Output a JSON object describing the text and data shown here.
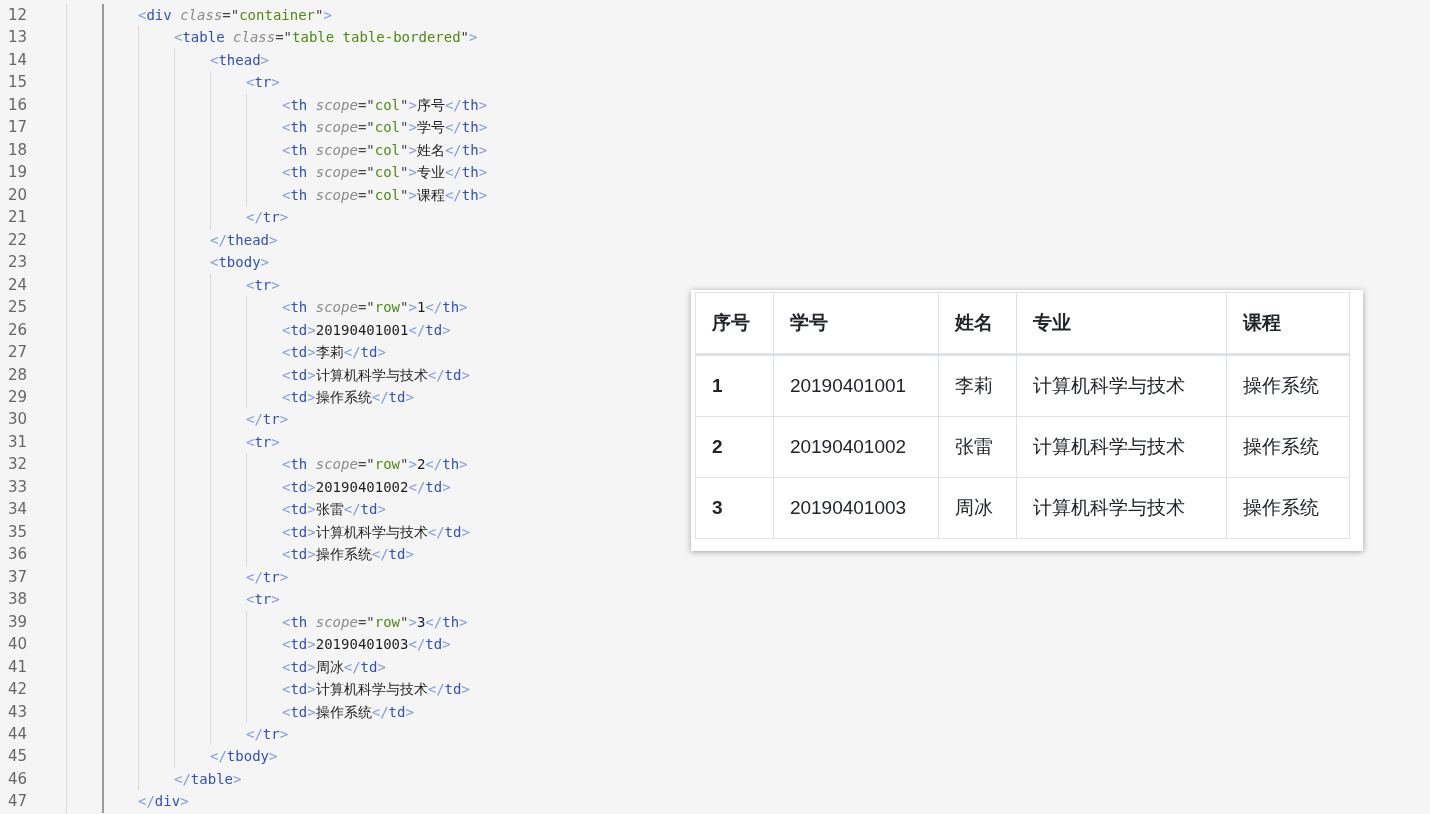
{
  "editor": {
    "lines": [
      {
        "number": "12",
        "tokens": [
          {
            "kind": "bracket",
            "text": "<"
          },
          {
            "kind": "tag",
            "text": "div"
          },
          {
            "kind": "attr",
            "text": " class"
          },
          {
            "kind": "plain",
            "text": "=\""
          },
          {
            "kind": "string",
            "text": "container"
          },
          {
            "kind": "plain",
            "text": "\""
          },
          {
            "kind": "bracket",
            "text": ">"
          }
        ],
        "children": [
          {
            "number": "13",
            "tokens": [
              {
                "kind": "bracket",
                "text": "<"
              },
              {
                "kind": "tag",
                "text": "table"
              },
              {
                "kind": "attr",
                "text": " class"
              },
              {
                "kind": "plain",
                "text": "=\""
              },
              {
                "kind": "string",
                "text": "table table-bordered"
              },
              {
                "kind": "plain",
                "text": "\""
              },
              {
                "kind": "bracket",
                "text": ">"
              }
            ],
            "children": [
              {
                "number": "14",
                "tokens": [
                  {
                    "kind": "bracket",
                    "text": "<"
                  },
                  {
                    "kind": "tag",
                    "text": "thead"
                  },
                  {
                    "kind": "bracket",
                    "text": ">"
                  }
                ],
                "children": [
                  {
                    "number": "15",
                    "tokens": [
                      {
                        "kind": "bracket",
                        "text": "<"
                      },
                      {
                        "kind": "tag",
                        "text": "tr"
                      },
                      {
                        "kind": "bracket",
                        "text": ">"
                      }
                    ],
                    "children": [
                      {
                        "number": "16",
                        "tokens": [
                          {
                            "kind": "bracket",
                            "text": "<"
                          },
                          {
                            "kind": "tag",
                            "text": "th"
                          },
                          {
                            "kind": "attr",
                            "text": " scope"
                          },
                          {
                            "kind": "plain",
                            "text": "=\""
                          },
                          {
                            "kind": "string",
                            "text": "col"
                          },
                          {
                            "kind": "plain",
                            "text": "\""
                          },
                          {
                            "kind": "bracket",
                            "text": ">"
                          },
                          {
                            "kind": "text",
                            "text": "序号"
                          },
                          {
                            "kind": "bracket",
                            "text": "</"
                          },
                          {
                            "kind": "tag",
                            "text": "th"
                          },
                          {
                            "kind": "bracket",
                            "text": ">"
                          }
                        ]
                      },
                      {
                        "number": "17",
                        "tokens": [
                          {
                            "kind": "bracket",
                            "text": "<"
                          },
                          {
                            "kind": "tag",
                            "text": "th"
                          },
                          {
                            "kind": "attr",
                            "text": " scope"
                          },
                          {
                            "kind": "plain",
                            "text": "=\""
                          },
                          {
                            "kind": "string",
                            "text": "col"
                          },
                          {
                            "kind": "plain",
                            "text": "\""
                          },
                          {
                            "kind": "bracket",
                            "text": ">"
                          },
                          {
                            "kind": "text",
                            "text": "学号"
                          },
                          {
                            "kind": "bracket",
                            "text": "</"
                          },
                          {
                            "kind": "tag",
                            "text": "th"
                          },
                          {
                            "kind": "bracket",
                            "text": ">"
                          }
                        ]
                      },
                      {
                        "number": "18",
                        "tokens": [
                          {
                            "kind": "bracket",
                            "text": "<"
                          },
                          {
                            "kind": "tag",
                            "text": "th"
                          },
                          {
                            "kind": "attr",
                            "text": " scope"
                          },
                          {
                            "kind": "plain",
                            "text": "=\""
                          },
                          {
                            "kind": "string",
                            "text": "col"
                          },
                          {
                            "kind": "plain",
                            "text": "\""
                          },
                          {
                            "kind": "bracket",
                            "text": ">"
                          },
                          {
                            "kind": "text",
                            "text": "姓名"
                          },
                          {
                            "kind": "bracket",
                            "text": "</"
                          },
                          {
                            "kind": "tag",
                            "text": "th"
                          },
                          {
                            "kind": "bracket",
                            "text": ">"
                          }
                        ]
                      },
                      {
                        "number": "19",
                        "tokens": [
                          {
                            "kind": "bracket",
                            "text": "<"
                          },
                          {
                            "kind": "tag",
                            "text": "th"
                          },
                          {
                            "kind": "attr",
                            "text": " scope"
                          },
                          {
                            "kind": "plain",
                            "text": "=\""
                          },
                          {
                            "kind": "string",
                            "text": "col"
                          },
                          {
                            "kind": "plain",
                            "text": "\""
                          },
                          {
                            "kind": "bracket",
                            "text": ">"
                          },
                          {
                            "kind": "text",
                            "text": "专业"
                          },
                          {
                            "kind": "bracket",
                            "text": "</"
                          },
                          {
                            "kind": "tag",
                            "text": "th"
                          },
                          {
                            "kind": "bracket",
                            "text": ">"
                          }
                        ]
                      },
                      {
                        "number": "20",
                        "tokens": [
                          {
                            "kind": "bracket",
                            "text": "<"
                          },
                          {
                            "kind": "tag",
                            "text": "th"
                          },
                          {
                            "kind": "attr",
                            "text": " scope"
                          },
                          {
                            "kind": "plain",
                            "text": "=\""
                          },
                          {
                            "kind": "string",
                            "text": "col"
                          },
                          {
                            "kind": "plain",
                            "text": "\""
                          },
                          {
                            "kind": "bracket",
                            "text": ">"
                          },
                          {
                            "kind": "text",
                            "text": "课程"
                          },
                          {
                            "kind": "bracket",
                            "text": "</"
                          },
                          {
                            "kind": "tag",
                            "text": "th"
                          },
                          {
                            "kind": "bracket",
                            "text": ">"
                          }
                        ]
                      }
                    ]
                  },
                  {
                    "number": "21",
                    "tokens": [
                      {
                        "kind": "bracket",
                        "text": "</"
                      },
                      {
                        "kind": "tag",
                        "text": "tr"
                      },
                      {
                        "kind": "bracket",
                        "text": ">"
                      }
                    ]
                  }
                ]
              },
              {
                "number": "22",
                "tokens": [
                  {
                    "kind": "bracket",
                    "text": "</"
                  },
                  {
                    "kind": "tag",
                    "text": "thead"
                  },
                  {
                    "kind": "bracket",
                    "text": ">"
                  }
                ]
              },
              {
                "number": "23",
                "tokens": [
                  {
                    "kind": "bracket",
                    "text": "<"
                  },
                  {
                    "kind": "tag",
                    "text": "tbody"
                  },
                  {
                    "kind": "bracket",
                    "text": ">"
                  }
                ],
                "children": [
                  {
                    "number": "24",
                    "tokens": [
                      {
                        "kind": "bracket",
                        "text": "<"
                      },
                      {
                        "kind": "tag",
                        "text": "tr"
                      },
                      {
                        "kind": "bracket",
                        "text": ">"
                      }
                    ],
                    "children": [
                      {
                        "number": "25",
                        "tokens": [
                          {
                            "kind": "bracket",
                            "text": "<"
                          },
                          {
                            "kind": "tag",
                            "text": "th"
                          },
                          {
                            "kind": "attr",
                            "text": " scope"
                          },
                          {
                            "kind": "plain",
                            "text": "=\""
                          },
                          {
                            "kind": "string",
                            "text": "row"
                          },
                          {
                            "kind": "plain",
                            "text": "\""
                          },
                          {
                            "kind": "bracket",
                            "text": ">"
                          },
                          {
                            "kind": "text",
                            "text": "1"
                          },
                          {
                            "kind": "bracket",
                            "text": "</"
                          },
                          {
                            "kind": "tag",
                            "text": "th"
                          },
                          {
                            "kind": "bracket",
                            "text": ">"
                          }
                        ]
                      },
                      {
                        "number": "26",
                        "tokens": [
                          {
                            "kind": "bracket",
                            "text": "<"
                          },
                          {
                            "kind": "tag",
                            "text": "td"
                          },
                          {
                            "kind": "bracket",
                            "text": ">"
                          },
                          {
                            "kind": "text",
                            "text": "20190401001"
                          },
                          {
                            "kind": "bracket",
                            "text": "</"
                          },
                          {
                            "kind": "tag",
                            "text": "td"
                          },
                          {
                            "kind": "bracket",
                            "text": ">"
                          }
                        ]
                      },
                      {
                        "number": "27",
                        "tokens": [
                          {
                            "kind": "bracket",
                            "text": "<"
                          },
                          {
                            "kind": "tag",
                            "text": "td"
                          },
                          {
                            "kind": "bracket",
                            "text": ">"
                          },
                          {
                            "kind": "text",
                            "text": "李莉"
                          },
                          {
                            "kind": "bracket",
                            "text": "</"
                          },
                          {
                            "kind": "tag",
                            "text": "td"
                          },
                          {
                            "kind": "bracket",
                            "text": ">"
                          }
                        ]
                      },
                      {
                        "number": "28",
                        "tokens": [
                          {
                            "kind": "bracket",
                            "text": "<"
                          },
                          {
                            "kind": "tag",
                            "text": "td"
                          },
                          {
                            "kind": "bracket",
                            "text": ">"
                          },
                          {
                            "kind": "text",
                            "text": "计算机科学与技术"
                          },
                          {
                            "kind": "bracket",
                            "text": "</"
                          },
                          {
                            "kind": "tag",
                            "text": "td"
                          },
                          {
                            "kind": "bracket",
                            "text": ">"
                          }
                        ]
                      },
                      {
                        "number": "29",
                        "tokens": [
                          {
                            "kind": "bracket",
                            "text": "<"
                          },
                          {
                            "kind": "tag",
                            "text": "td"
                          },
                          {
                            "kind": "bracket",
                            "text": ">"
                          },
                          {
                            "kind": "text",
                            "text": "操作系统"
                          },
                          {
                            "kind": "bracket",
                            "text": "</"
                          },
                          {
                            "kind": "tag",
                            "text": "td"
                          },
                          {
                            "kind": "bracket",
                            "text": ">"
                          }
                        ]
                      }
                    ]
                  },
                  {
                    "number": "30",
                    "tokens": [
                      {
                        "kind": "bracket",
                        "text": "</"
                      },
                      {
                        "kind": "tag",
                        "text": "tr"
                      },
                      {
                        "kind": "bracket",
                        "text": ">"
                      }
                    ]
                  },
                  {
                    "number": "31",
                    "tokens": [
                      {
                        "kind": "bracket",
                        "text": "<"
                      },
                      {
                        "kind": "tag",
                        "text": "tr"
                      },
                      {
                        "kind": "bracket",
                        "text": ">"
                      }
                    ],
                    "children": [
                      {
                        "number": "32",
                        "tokens": [
                          {
                            "kind": "bracket",
                            "text": "<"
                          },
                          {
                            "kind": "tag",
                            "text": "th"
                          },
                          {
                            "kind": "attr",
                            "text": " scope"
                          },
                          {
                            "kind": "plain",
                            "text": "=\""
                          },
                          {
                            "kind": "string",
                            "text": "row"
                          },
                          {
                            "kind": "plain",
                            "text": "\""
                          },
                          {
                            "kind": "bracket",
                            "text": ">"
                          },
                          {
                            "kind": "text",
                            "text": "2"
                          },
                          {
                            "kind": "bracket",
                            "text": "</"
                          },
                          {
                            "kind": "tag",
                            "text": "th"
                          },
                          {
                            "kind": "bracket",
                            "text": ">"
                          }
                        ]
                      },
                      {
                        "number": "33",
                        "tokens": [
                          {
                            "kind": "bracket",
                            "text": "<"
                          },
                          {
                            "kind": "tag",
                            "text": "td"
                          },
                          {
                            "kind": "bracket",
                            "text": ">"
                          },
                          {
                            "kind": "text",
                            "text": "20190401002"
                          },
                          {
                            "kind": "bracket",
                            "text": "</"
                          },
                          {
                            "kind": "tag",
                            "text": "td"
                          },
                          {
                            "kind": "bracket",
                            "text": ">"
                          }
                        ]
                      },
                      {
                        "number": "34",
                        "tokens": [
                          {
                            "kind": "bracket",
                            "text": "<"
                          },
                          {
                            "kind": "tag",
                            "text": "td"
                          },
                          {
                            "kind": "bracket",
                            "text": ">"
                          },
                          {
                            "kind": "text",
                            "text": "张雷"
                          },
                          {
                            "kind": "bracket",
                            "text": "</"
                          },
                          {
                            "kind": "tag",
                            "text": "td"
                          },
                          {
                            "kind": "bracket",
                            "text": ">"
                          }
                        ]
                      },
                      {
                        "number": "35",
                        "tokens": [
                          {
                            "kind": "bracket",
                            "text": "<"
                          },
                          {
                            "kind": "tag",
                            "text": "td"
                          },
                          {
                            "kind": "bracket",
                            "text": ">"
                          },
                          {
                            "kind": "text",
                            "text": "计算机科学与技术"
                          },
                          {
                            "kind": "bracket",
                            "text": "</"
                          },
                          {
                            "kind": "tag",
                            "text": "td"
                          },
                          {
                            "kind": "bracket",
                            "text": ">"
                          }
                        ]
                      },
                      {
                        "number": "36",
                        "tokens": [
                          {
                            "kind": "bracket",
                            "text": "<"
                          },
                          {
                            "kind": "tag",
                            "text": "td"
                          },
                          {
                            "kind": "bracket",
                            "text": ">"
                          },
                          {
                            "kind": "text",
                            "text": "操作系统"
                          },
                          {
                            "kind": "bracket",
                            "text": "</"
                          },
                          {
                            "kind": "tag",
                            "text": "td"
                          },
                          {
                            "kind": "bracket",
                            "text": ">"
                          }
                        ]
                      }
                    ]
                  },
                  {
                    "number": "37",
                    "tokens": [
                      {
                        "kind": "bracket",
                        "text": "</"
                      },
                      {
                        "kind": "tag",
                        "text": "tr"
                      },
                      {
                        "kind": "bracket",
                        "text": ">"
                      }
                    ]
                  },
                  {
                    "number": "38",
                    "tokens": [
                      {
                        "kind": "bracket",
                        "text": "<"
                      },
                      {
                        "kind": "tag",
                        "text": "tr"
                      },
                      {
                        "kind": "bracket",
                        "text": ">"
                      }
                    ],
                    "children": [
                      {
                        "number": "39",
                        "tokens": [
                          {
                            "kind": "bracket",
                            "text": "<"
                          },
                          {
                            "kind": "tag",
                            "text": "th"
                          },
                          {
                            "kind": "attr",
                            "text": " scope"
                          },
                          {
                            "kind": "plain",
                            "text": "=\""
                          },
                          {
                            "kind": "string",
                            "text": "row"
                          },
                          {
                            "kind": "plain",
                            "text": "\""
                          },
                          {
                            "kind": "bracket",
                            "text": ">"
                          },
                          {
                            "kind": "text",
                            "text": "3"
                          },
                          {
                            "kind": "bracket",
                            "text": "</"
                          },
                          {
                            "kind": "tag",
                            "text": "th"
                          },
                          {
                            "kind": "bracket",
                            "text": ">"
                          }
                        ]
                      },
                      {
                        "number": "40",
                        "tokens": [
                          {
                            "kind": "bracket",
                            "text": "<"
                          },
                          {
                            "kind": "tag",
                            "text": "td"
                          },
                          {
                            "kind": "bracket",
                            "text": ">"
                          },
                          {
                            "kind": "text",
                            "text": "20190401003"
                          },
                          {
                            "kind": "bracket",
                            "text": "</"
                          },
                          {
                            "kind": "tag",
                            "text": "td"
                          },
                          {
                            "kind": "bracket",
                            "text": ">"
                          }
                        ]
                      },
                      {
                        "number": "41",
                        "tokens": [
                          {
                            "kind": "bracket",
                            "text": "<"
                          },
                          {
                            "kind": "tag",
                            "text": "td"
                          },
                          {
                            "kind": "bracket",
                            "text": ">"
                          },
                          {
                            "kind": "text",
                            "text": "周冰"
                          },
                          {
                            "kind": "bracket",
                            "text": "</"
                          },
                          {
                            "kind": "tag",
                            "text": "td"
                          },
                          {
                            "kind": "bracket",
                            "text": ">"
                          }
                        ]
                      },
                      {
                        "number": "42",
                        "tokens": [
                          {
                            "kind": "bracket",
                            "text": "<"
                          },
                          {
                            "kind": "tag",
                            "text": "td"
                          },
                          {
                            "kind": "bracket",
                            "text": ">"
                          },
                          {
                            "kind": "text",
                            "text": "计算机科学与技术"
                          },
                          {
                            "kind": "bracket",
                            "text": "</"
                          },
                          {
                            "kind": "tag",
                            "text": "td"
                          },
                          {
                            "kind": "bracket",
                            "text": ">"
                          }
                        ]
                      },
                      {
                        "number": "43",
                        "tokens": [
                          {
                            "kind": "bracket",
                            "text": "<"
                          },
                          {
                            "kind": "tag",
                            "text": "td"
                          },
                          {
                            "kind": "bracket",
                            "text": ">"
                          },
                          {
                            "kind": "text",
                            "text": "操作系统"
                          },
                          {
                            "kind": "bracket",
                            "text": "</"
                          },
                          {
                            "kind": "tag",
                            "text": "td"
                          },
                          {
                            "kind": "bracket",
                            "text": ">"
                          }
                        ]
                      }
                    ]
                  },
                  {
                    "number": "44",
                    "tokens": [
                      {
                        "kind": "bracket",
                        "text": "</"
                      },
                      {
                        "kind": "tag",
                        "text": "tr"
                      },
                      {
                        "kind": "bracket",
                        "text": ">"
                      }
                    ]
                  }
                ]
              },
              {
                "number": "45",
                "tokens": [
                  {
                    "kind": "bracket",
                    "text": "</"
                  },
                  {
                    "kind": "tag",
                    "text": "tbody"
                  },
                  {
                    "kind": "bracket",
                    "text": ">"
                  }
                ]
              }
            ]
          },
          {
            "number": "46",
            "tokens": [
              {
                "kind": "bracket",
                "text": "</"
              },
              {
                "kind": "tag",
                "text": "table"
              },
              {
                "kind": "bracket",
                "text": ">"
              }
            ]
          }
        ]
      },
      {
        "number": "47",
        "tokens": [
          {
            "kind": "bracket",
            "text": "</"
          },
          {
            "kind": "tag",
            "text": "div"
          },
          {
            "kind": "bracket",
            "text": ">"
          }
        ]
      }
    ]
  },
  "preview_table": {
    "columns": [
      "序号",
      "学号",
      "姓名",
      "专业",
      "课程"
    ],
    "rows": [
      {
        "cells": [
          "1",
          "20190401001",
          "李莉",
          "计算机科学与技术",
          "操作系统"
        ]
      },
      {
        "cells": [
          "2",
          "20190401002",
          "张雷",
          "计算机科学与技术",
          "操作系统"
        ]
      },
      {
        "cells": [
          "3",
          "20190401003",
          "周冰",
          "计算机科学与技术",
          "操作系统"
        ]
      }
    ]
  }
}
